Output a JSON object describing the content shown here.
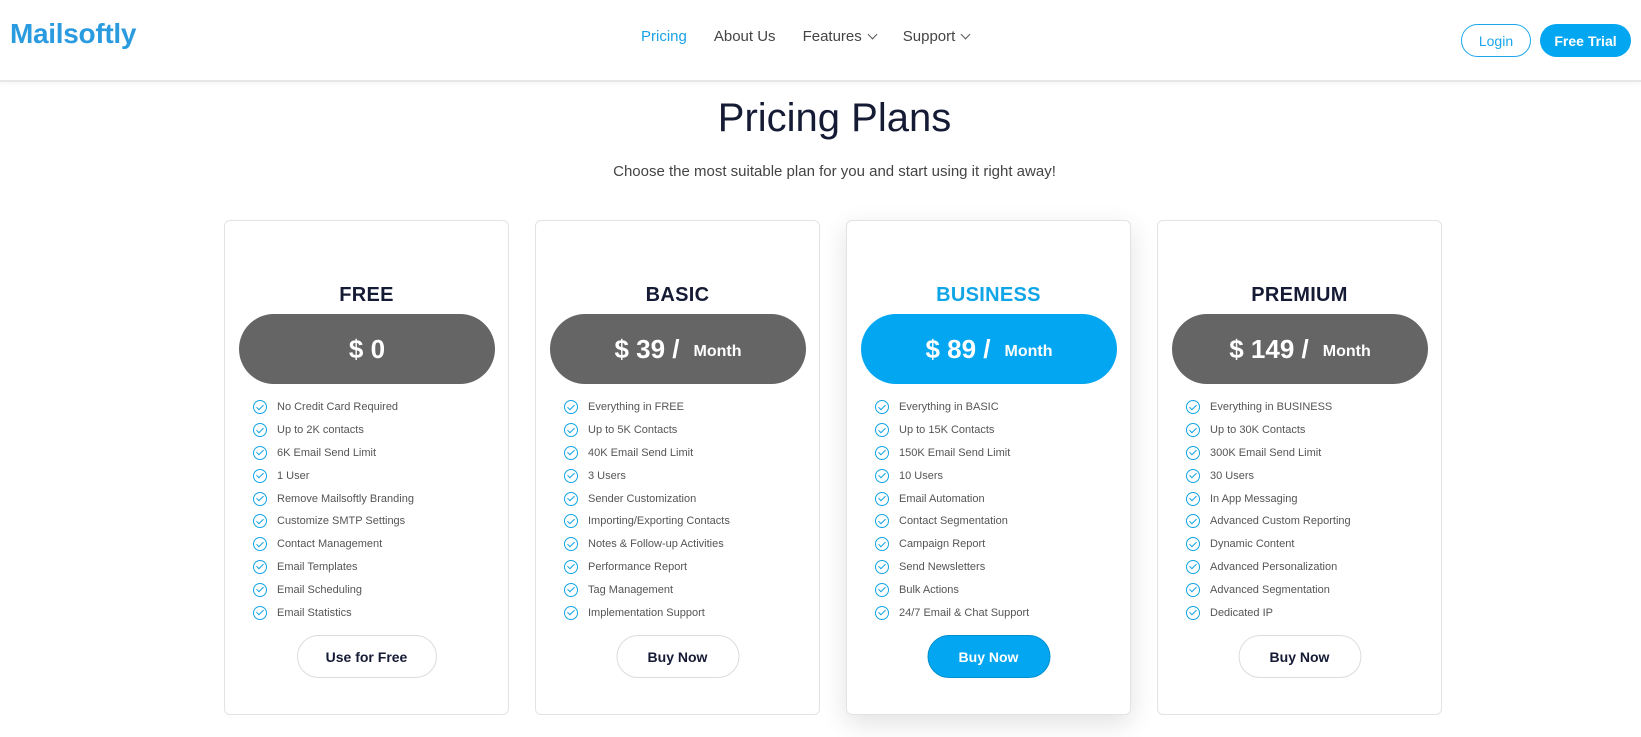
{
  "brand": {
    "logo": "Mailsoftly",
    "accent": "#03a6f0",
    "logo_color": "#2b9be0"
  },
  "nav": {
    "items": [
      {
        "label": "Pricing",
        "active": true,
        "dropdown": false
      },
      {
        "label": "About Us",
        "active": false,
        "dropdown": false
      },
      {
        "label": "Features",
        "active": false,
        "dropdown": true
      },
      {
        "label": "Support",
        "active": false,
        "dropdown": true
      }
    ],
    "login_label": "Login",
    "trial_label": "Free Trial"
  },
  "page": {
    "title": "Pricing Plans",
    "subtitle": "Choose the most suitable plan for you and start using it right away!"
  },
  "plans": [
    {
      "name": "FREE",
      "price": "$ 0",
      "period": "",
      "featured": false,
      "features": [
        "No Credit Card Required",
        "Up to 2K contacts",
        "6K Email Send Limit",
        "1 User",
        "Remove Mailsoftly Branding",
        "Customize SMTP Settings",
        "Contact Management",
        "Email Templates",
        "Email Scheduling",
        "Email Statistics"
      ],
      "cta": "Use for Free"
    },
    {
      "name": "BASIC",
      "price": "$ 39 /",
      "period": "Month",
      "featured": false,
      "features": [
        "Everything in FREE",
        "Up to 5K Contacts",
        "40K Email Send Limit",
        "3 Users",
        "Sender Customization",
        "Importing/Exporting Contacts",
        "Notes & Follow-up Activities",
        "Performance Report",
        "Tag Management",
        "Implementation Support"
      ],
      "cta": "Buy Now"
    },
    {
      "name": "BUSINESS",
      "price": "$ 89 /",
      "period": "Month",
      "featured": true,
      "features": [
        "Everything in BASIC",
        "Up to 15K Contacts",
        "150K Email Send Limit",
        "10 Users",
        "Email Automation",
        "Contact Segmentation",
        "Campaign Report",
        "Send Newsletters",
        "Bulk Actions",
        "24/7 Email & Chat Support"
      ],
      "cta": "Buy Now"
    },
    {
      "name": "PREMIUM",
      "price": "$ 149 /",
      "period": "Month",
      "featured": false,
      "features": [
        "Everything in BUSINESS",
        "Up to 30K Contacts",
        "300K Email Send Limit",
        "30 Users",
        "In App Messaging",
        "Advanced Custom Reporting",
        "Dynamic Content",
        "Advanced Personalization",
        "Advanced Segmentation",
        "Dedicated IP"
      ],
      "cta": "Buy Now"
    }
  ],
  "icons": {
    "check": "check-circle-icon",
    "dropdown": "chevron-down-icon"
  }
}
